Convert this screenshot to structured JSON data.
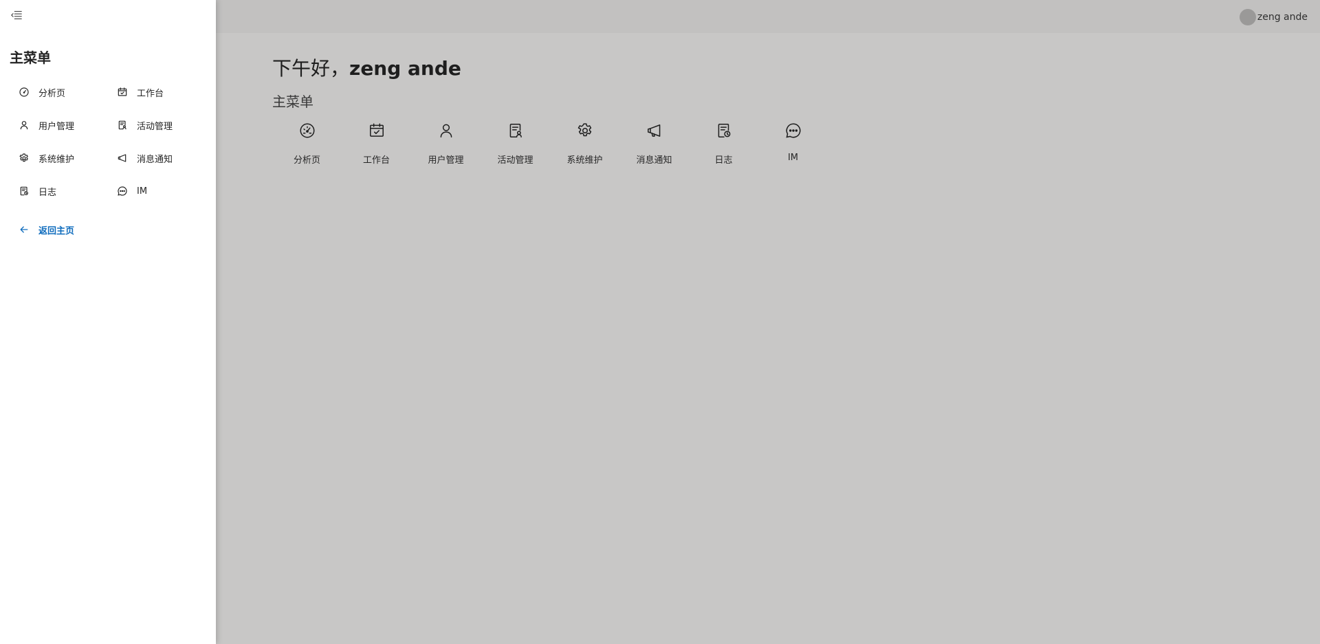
{
  "header": {
    "user_name": "zeng ande"
  },
  "main": {
    "greeting_prefix": "下午好，",
    "greeting_name": "zeng ande",
    "section_title": "主菜单",
    "tiles": [
      {
        "label": "分析页",
        "icon": "gauge-icon"
      },
      {
        "label": "工作台",
        "icon": "calendar-check-icon"
      },
      {
        "label": "用户管理",
        "icon": "person-icon"
      },
      {
        "label": "活动管理",
        "icon": "document-person-icon"
      },
      {
        "label": "系统维护",
        "icon": "gear-icon"
      },
      {
        "label": "消息通知",
        "icon": "megaphone-icon"
      },
      {
        "label": "日志",
        "icon": "document-clock-icon"
      },
      {
        "label": "IM",
        "icon": "chat-icon"
      }
    ]
  },
  "drawer": {
    "title": "主菜单",
    "items": [
      {
        "label": "分析页",
        "icon": "gauge-icon"
      },
      {
        "label": "工作台",
        "icon": "calendar-check-icon"
      },
      {
        "label": "用户管理",
        "icon": "person-icon"
      },
      {
        "label": "活动管理",
        "icon": "document-person-icon"
      },
      {
        "label": "系统维护",
        "icon": "gear-icon"
      },
      {
        "label": "消息通知",
        "icon": "megaphone-icon"
      },
      {
        "label": "日志",
        "icon": "document-clock-icon"
      },
      {
        "label": "IM",
        "icon": "chat-icon"
      }
    ],
    "back_label": "返回主页"
  },
  "colors": {
    "accent": "#0f6cbd",
    "overlay_bg": "#c8c7c6",
    "drawer_bg": "#ffffff"
  }
}
